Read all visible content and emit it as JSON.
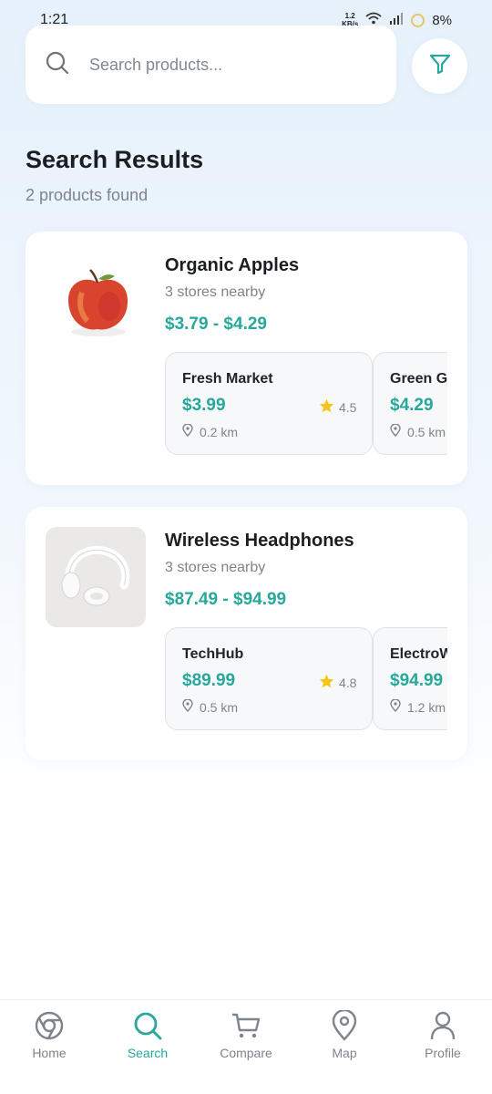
{
  "status_bar": {
    "time": "1:21",
    "net_speed_value": "1.2",
    "net_speed_unit": "KB/s",
    "battery": "8%"
  },
  "search": {
    "placeholder": "Search products...",
    "value": ""
  },
  "header": {
    "title": "Search Results",
    "count_text": "2 products found"
  },
  "colors": {
    "accent": "#27a89a",
    "star": "#f5c518",
    "muted_text": "#7d848b"
  },
  "products": [
    {
      "name": "Organic Apples",
      "stores_text": "3 stores nearby",
      "price_range": "$3.79 - $4.29",
      "image_icon": "apple-image",
      "stores": [
        {
          "name": "Fresh Market",
          "price": "$3.99",
          "rating": "4.5",
          "distance": "0.2 km"
        },
        {
          "name": "Green Gr",
          "price": "$4.29",
          "rating": "",
          "distance": "0.5 km"
        }
      ]
    },
    {
      "name": "Wireless Headphones",
      "stores_text": "3 stores nearby",
      "price_range": "$87.49 - $94.99",
      "image_icon": "headphones-image",
      "stores": [
        {
          "name": "TechHub",
          "price": "$89.99",
          "rating": "4.8",
          "distance": "0.5 km"
        },
        {
          "name": "ElectroW",
          "price": "$94.99",
          "rating": "",
          "distance": "1.2 km"
        }
      ]
    }
  ],
  "nav": {
    "items": [
      {
        "label": "Home",
        "icon": "home-icon",
        "active": false
      },
      {
        "label": "Search",
        "icon": "search-icon",
        "active": true
      },
      {
        "label": "Compare",
        "icon": "cart-icon",
        "active": false
      },
      {
        "label": "Map",
        "icon": "map-pin-icon",
        "active": false
      },
      {
        "label": "Profile",
        "icon": "user-icon",
        "active": false
      }
    ]
  }
}
